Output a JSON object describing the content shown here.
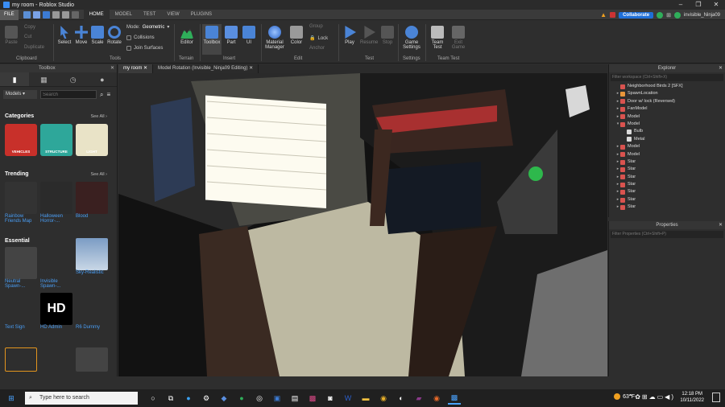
{
  "window": {
    "title": "my room - Roblox Studio"
  },
  "menubar": {
    "file": "FILE",
    "tabs": [
      "HOME",
      "MODEL",
      "TEST",
      "VIEW",
      "PLUGINS"
    ],
    "collaborate": "Collaborate",
    "username": "invisible_Ninja09"
  },
  "ribbon": {
    "clipboard": {
      "paste": "Paste",
      "copy": "Copy",
      "cut": "Cut",
      "duplicate": "Duplicate",
      "label": "Clipboard"
    },
    "tools": {
      "select": "Select",
      "move": "Move",
      "scale": "Scale",
      "rotate": "Rotate",
      "mode_label": "Mode:",
      "mode_value": "Geometric",
      "collisions": "Collisions",
      "join_surfaces": "Join Surfaces",
      "label": "Tools"
    },
    "terrain": {
      "editor": "Editor",
      "label": "Terrain"
    },
    "insert": {
      "toolbox": "Toolbox",
      "part": "Part",
      "ui": "UI",
      "label": "Insert"
    },
    "edit": {
      "material": "Material Manager",
      "color": "Color",
      "group": "Group",
      "lock": "Lock",
      "anchor": "Anchor",
      "label": "Edit"
    },
    "test": {
      "play": "Play",
      "resume": "Resume",
      "stop": "Stop",
      "label": "Test"
    },
    "settings": {
      "game_settings": "Game Settings",
      "label": "Settings"
    },
    "team_test": {
      "team_test": "Team Test",
      "exit_game": "Exit Game",
      "label": "Team Test"
    }
  },
  "toolbox": {
    "header": "Toolbox",
    "dropdown": "Models",
    "search_placeholder": "Search",
    "categories_title": "Categories",
    "see_all": "See All ›",
    "categories": [
      {
        "label": "VEHICLES",
        "color": "#c8302a"
      },
      {
        "label": "STRUCTURE",
        "color": "#2ea79a"
      },
      {
        "label": "LIGHT",
        "color": "#e9e3c7"
      }
    ],
    "trending_title": "Trending",
    "trending": [
      "Rainbow Friends Map",
      "Halloween Horror-...",
      "Blood"
    ],
    "essential_title": "Essential",
    "essential": [
      "Neutral Spawn-...",
      "Invisible Spawn-...",
      "Sky-Realistic"
    ],
    "row4": [
      "Text Sign",
      "HD Admin",
      "R6 Dummy"
    ],
    "hd_text": "HD"
  },
  "viewport": {
    "tabs": [
      "my room",
      "Model Rotation (Invisible_Ninja09 Editing)"
    ]
  },
  "explorer": {
    "title": "Explorer",
    "filter_placeholder": "Filter workspace (Ctrl+Shift+X)",
    "items": [
      {
        "label": "Neighborhood Birds 2 [SFX]",
        "indent": 1,
        "arrow": ""
      },
      {
        "label": "SpawnLocation",
        "indent": 1,
        "arrow": "▸"
      },
      {
        "label": "Door w/ lock (Reversed)",
        "indent": 1,
        "arrow": "▸"
      },
      {
        "label": "FanModel",
        "indent": 1,
        "arrow": "▸"
      },
      {
        "label": "Model",
        "indent": 1,
        "arrow": "▸"
      },
      {
        "label": "Model",
        "indent": 1,
        "arrow": "▾"
      },
      {
        "label": "Bulb",
        "indent": 2,
        "arrow": ""
      },
      {
        "label": "Metal",
        "indent": 2,
        "arrow": ""
      },
      {
        "label": "Model",
        "indent": 1,
        "arrow": "▸"
      },
      {
        "label": "Model",
        "indent": 1,
        "arrow": "▸"
      },
      {
        "label": "Star",
        "indent": 1,
        "arrow": "▸"
      },
      {
        "label": "Star",
        "indent": 1,
        "arrow": "▸"
      },
      {
        "label": "Star",
        "indent": 1,
        "arrow": "▸"
      },
      {
        "label": "Star",
        "indent": 1,
        "arrow": "▸"
      },
      {
        "label": "Star",
        "indent": 1,
        "arrow": "▸"
      },
      {
        "label": "Star",
        "indent": 1,
        "arrow": "▸"
      },
      {
        "label": "Star",
        "indent": 1,
        "arrow": "▸"
      }
    ]
  },
  "properties": {
    "title": "Properties",
    "filter_placeholder": "Filter Properties (Ctrl+Shift+P)"
  },
  "taskbar": {
    "search_placeholder": "Type here to search",
    "temperature": "63°F",
    "time": "12:18 PM",
    "date": "10/11/2022"
  }
}
